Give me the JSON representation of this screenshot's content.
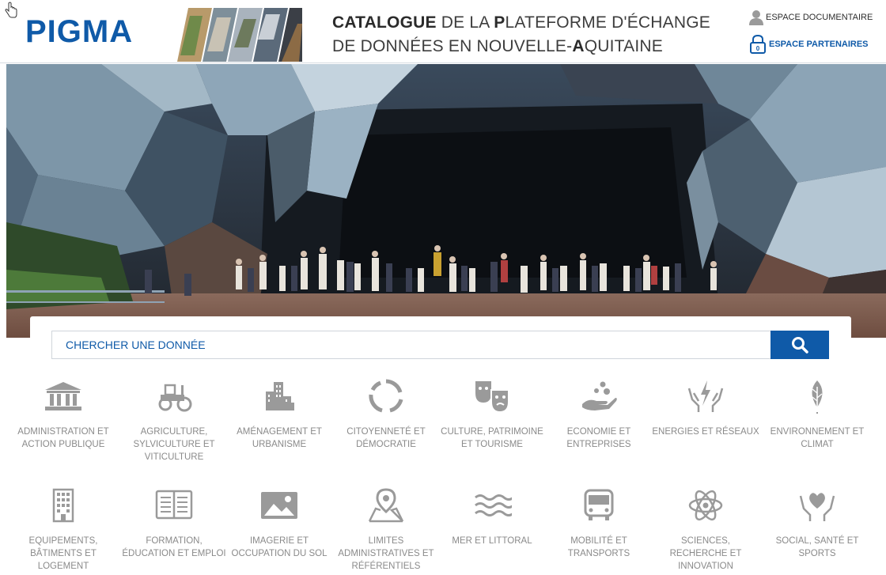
{
  "header": {
    "logo": "PIGMA",
    "title_line1_parts": [
      {
        "t": "CATALOGUE",
        "b": true
      },
      {
        "t": " DE LA ",
        "b": false
      },
      {
        "t": "P",
        "b": true
      },
      {
        "t": "LATEFORME D'ÉCHANGE",
        "b": false
      }
    ],
    "title_line2_parts": [
      {
        "t": "DE DONNÉES EN NOUVELLE-",
        "b": false
      },
      {
        "t": "A",
        "b": true
      },
      {
        "t": "QUITAINE",
        "b": false
      }
    ],
    "espace_documentaire": "ESPACE DOCUMENTAIRE",
    "espace_partenaires": "ESPACE PARTENAIRES"
  },
  "search": {
    "placeholder": "CHERCHER UNE DONNÉE"
  },
  "colors": {
    "brand_blue": "#0f5aa8",
    "icon_gray": "#9a9a9a",
    "label_gray": "#8a8a8a"
  },
  "categories": [
    {
      "label": "ADMINISTRATION ET ACTION PUBLIQUE",
      "icon": "building-icon"
    },
    {
      "label": "AGRICULTURE, SYLVICULTURE ET VITICULTURE",
      "icon": "tractor-icon"
    },
    {
      "label": "AMÉNAGEMENT ET URBANISME",
      "icon": "city-icon"
    },
    {
      "label": "CITOYENNETÉ ET DÉMOCRATIE",
      "icon": "circle-arrows-icon"
    },
    {
      "label": "CULTURE, PATRIMOINE ET TOURISME",
      "icon": "theater-masks-icon"
    },
    {
      "label": "ECONOMIE ET ENTREPRISES",
      "icon": "hand-coins-icon"
    },
    {
      "label": "ENERGIES ET RÉSEAUX",
      "icon": "energy-hands-icon"
    },
    {
      "label": "ENVIRONNEMENT ET CLIMAT",
      "icon": "leaf-icon"
    },
    {
      "label": "EQUIPEMENTS, BÂTIMENTS ET LOGEMENT",
      "icon": "tower-icon"
    },
    {
      "label": "FORMATION, ÉDUCATION ET EMPLOI",
      "icon": "book-icon"
    },
    {
      "label": "IMAGERIE ET OCCUPATION DU SOL",
      "icon": "image-icon"
    },
    {
      "label": "LIMITES ADMINISTRATIVES ET RÉFÉRENTIELS",
      "icon": "map-pin-icon"
    },
    {
      "label": "MER ET LITTORAL",
      "icon": "waves-icon"
    },
    {
      "label": "MOBILITÉ ET TRANSPORTS",
      "icon": "bus-icon"
    },
    {
      "label": "SCIENCES, RECHERCHE ET INNOVATION",
      "icon": "atom-icon"
    },
    {
      "label": "SOCIAL, SANTÉ ET SPORTS",
      "icon": "heart-hands-icon"
    }
  ]
}
